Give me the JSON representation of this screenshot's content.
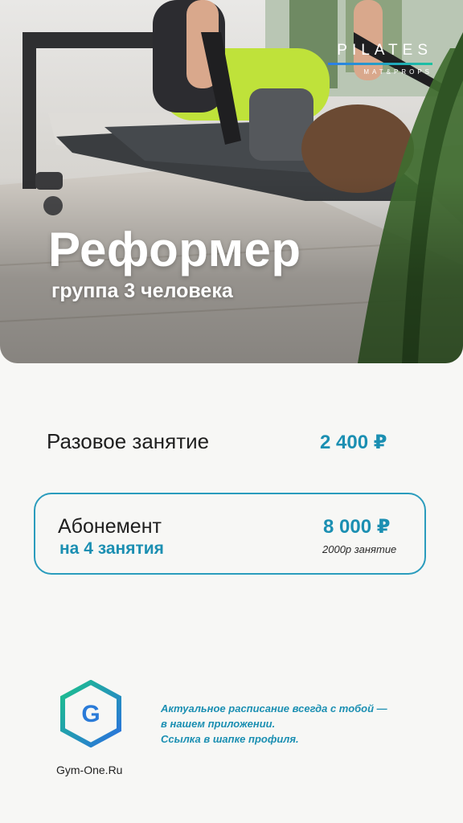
{
  "brand": {
    "name": "PILATES",
    "tagline": "MAT&PROPS",
    "line_colors": [
      "#2b7de9",
      "#1cc2a0"
    ]
  },
  "hero": {
    "title": "Реформер",
    "subtitle": "группа 3 человека"
  },
  "single_session": {
    "label": "Разовое занятие",
    "price": "2 400 ₽"
  },
  "subscription": {
    "label": "Абонемент",
    "sessions": "на 4 занятия",
    "price": "8 000 ₽",
    "per_session": "2000р занятие"
  },
  "footer": {
    "logo_letter": "G",
    "logo_text": "Gym-One.Ru",
    "promo_lines": [
      "Актуальное расписание всегда с тобой —",
      "в нашем приложении.",
      "Ссылка в шапке профиля."
    ]
  },
  "colors": {
    "accent": "#1b8fb2",
    "box_border": "#2a9cbd",
    "text": "#1f1f1f",
    "background": "#f7f7f5"
  },
  "icons": {
    "logo": "hexagon-g-icon"
  }
}
